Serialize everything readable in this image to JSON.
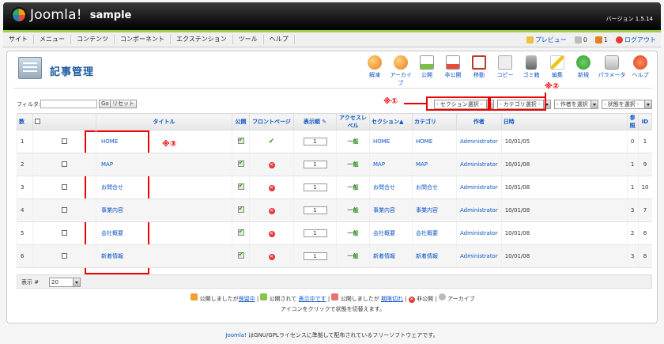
{
  "header": {
    "brand": "Joomla!",
    "site_name": "sample",
    "version": "バージョン 1.5.14"
  },
  "menu": {
    "items": [
      "サイト",
      "メニュー",
      "コンテンツ",
      "コンポーネント",
      "エクステンション",
      "ツール",
      "ヘルプ"
    ],
    "preview": "プレビュー",
    "messages_count": "0",
    "users_count": "1",
    "logout": "ログアウト"
  },
  "toolbar": {
    "title": "記事管理",
    "buttons": [
      "解凍",
      "アーカイブ",
      "公開",
      "非公開",
      "移動",
      "コピー",
      "ゴミ箱",
      "編集",
      "新規",
      "パラメータ",
      "ヘルプ"
    ]
  },
  "filter": {
    "label": "フィルタ:",
    "go": "Go",
    "reset": "リセット",
    "section_select": "- セクション選択 -",
    "category_select": "- カテゴリ選択 -",
    "author_select": "- 作者を選択 -",
    "state_select": "- 状態を選択 -"
  },
  "annotations": {
    "n1": "※①",
    "n2": "※②",
    "n3": "※③"
  },
  "table": {
    "headers": {
      "num": "数",
      "title": "タイトル",
      "published": "公開",
      "frontpage": "フロントページ",
      "order": "表示順",
      "access": "アクセスレベル",
      "section": "セクション▲",
      "category": "カテゴリ",
      "author": "作者",
      "date": "日時",
      "hits": "参照",
      "id": "ID"
    },
    "rows": [
      {
        "num": "1",
        "title": "HOME",
        "frontpage": true,
        "order": "1",
        "access": "一般",
        "section": "HOME",
        "category": "HOME",
        "author": "Administrator",
        "date": "10/01/05",
        "hits": "0",
        "id": "1"
      },
      {
        "num": "2",
        "title": "MAP",
        "frontpage": false,
        "order": "1",
        "access": "一般",
        "section": "MAP",
        "category": "MAP",
        "author": "Administrator",
        "date": "10/01/08",
        "hits": "1",
        "id": "9"
      },
      {
        "num": "3",
        "title": "お問合せ",
        "frontpage": false,
        "order": "1",
        "access": "一般",
        "section": "お問合せ",
        "category": "お問合せ",
        "author": "Administrator",
        "date": "10/01/08",
        "hits": "1",
        "id": "10"
      },
      {
        "num": "4",
        "title": "事業内容",
        "frontpage": false,
        "order": "1",
        "access": "一般",
        "section": "事業内容",
        "category": "事業内容",
        "author": "Administrator",
        "date": "10/01/08",
        "hits": "3",
        "id": "7"
      },
      {
        "num": "5",
        "title": "会社概要",
        "frontpage": false,
        "order": "1",
        "access": "一般",
        "section": "会社概要",
        "category": "会社概要",
        "author": "Administrator",
        "date": "10/01/08",
        "hits": "2",
        "id": "6"
      },
      {
        "num": "6",
        "title": "新着情報",
        "frontpage": false,
        "order": "1",
        "access": "一般",
        "section": "新着情報",
        "category": "新着情報",
        "author": "Administrator",
        "date": "10/01/08",
        "hits": "3",
        "id": "8"
      }
    ]
  },
  "pager": {
    "label": "表示 #",
    "value": "20"
  },
  "legend": {
    "pending_a": "公開しましたが",
    "pending_b": "保留中",
    "current_a": "公開されて",
    "current_b": "表示中です",
    "expired_a": "公開しましたが",
    "expired_b": "期限切れ",
    "unpublished": "非公開",
    "archived": "アーカイブ",
    "hint": "アイコンをクリックで状態を切替えます。"
  },
  "footer": {
    "link": "Joomla!",
    "text": "はGNU/GPLライセンスに準拠して配布されているフリーソフトウェアです。"
  }
}
